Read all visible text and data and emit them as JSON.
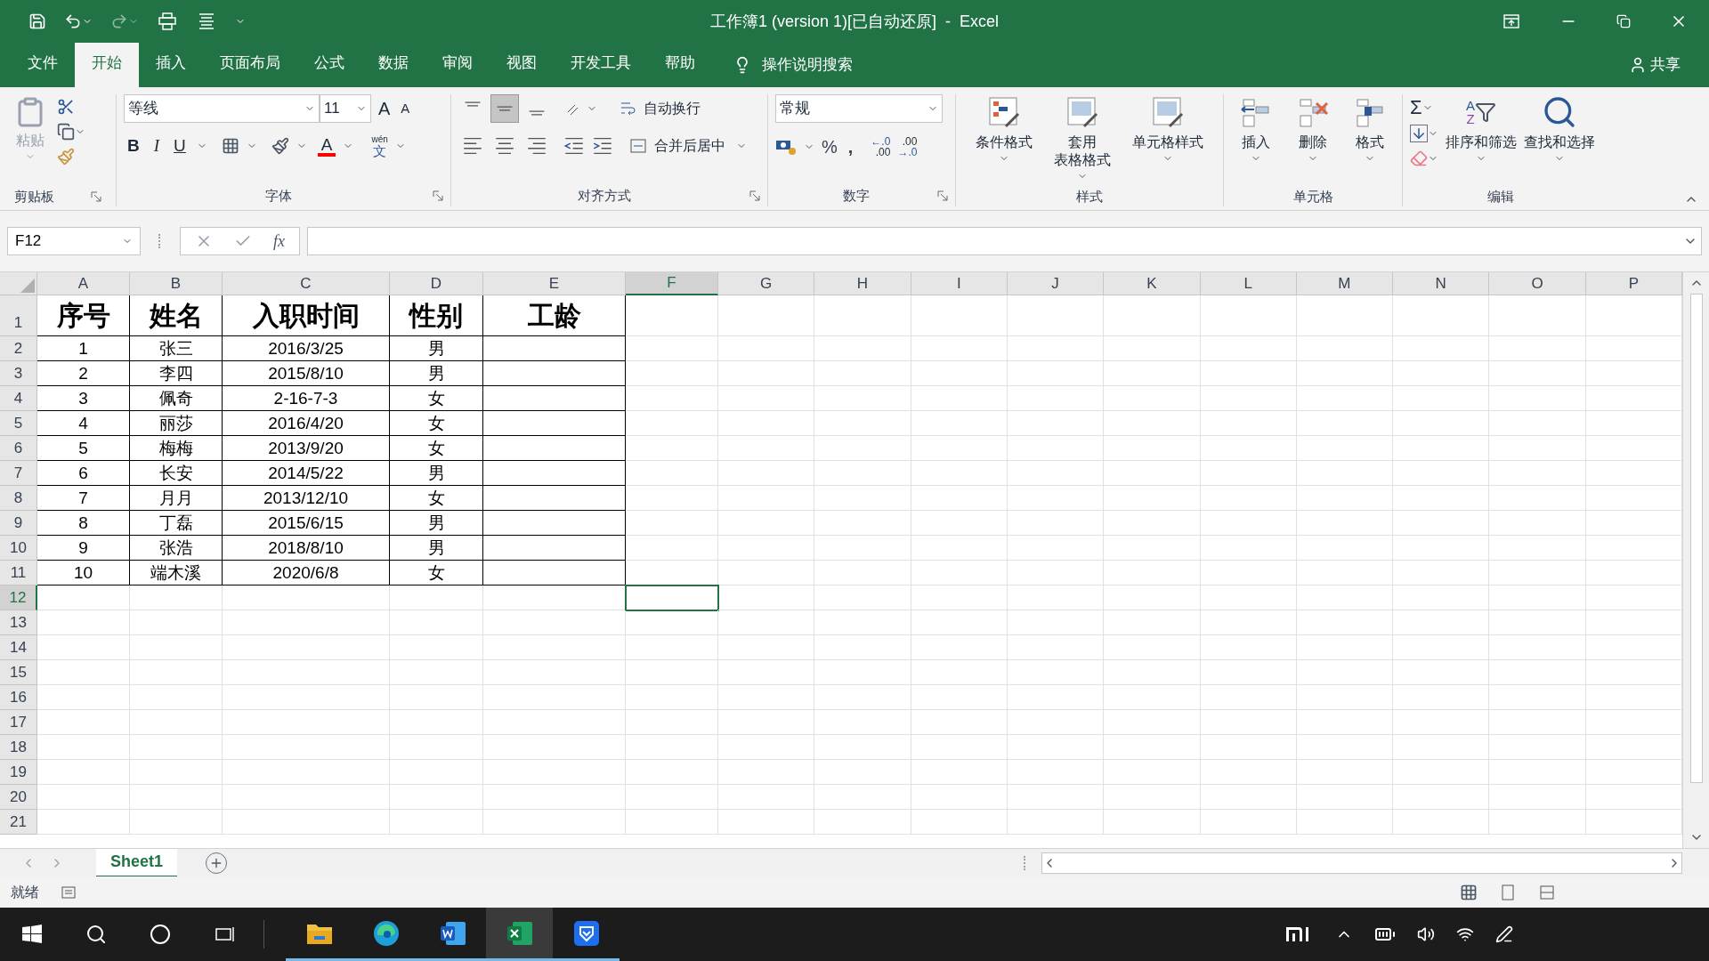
{
  "window": {
    "title": "工作簿1 (version 1)[已自动还原]  -  Excel"
  },
  "menu_tabs": [
    {
      "label": "文件",
      "selected": false
    },
    {
      "label": "开始",
      "selected": true
    },
    {
      "label": "插入",
      "selected": false
    },
    {
      "label": "页面布局",
      "selected": false
    },
    {
      "label": "公式",
      "selected": false
    },
    {
      "label": "数据",
      "selected": false
    },
    {
      "label": "审阅",
      "selected": false
    },
    {
      "label": "视图",
      "selected": false
    },
    {
      "label": "开发工具",
      "selected": false
    },
    {
      "label": "帮助",
      "selected": false
    }
  ],
  "tell_me": "操作说明搜索",
  "share": "共享",
  "ribbon": {
    "clipboard": {
      "paste": "粘贴",
      "label": "剪贴板"
    },
    "font": {
      "name": "等线",
      "size": "11",
      "grow": "A",
      "shrink": "A",
      "bold": "B",
      "italic": "I",
      "underline": "U",
      "font_color": "A",
      "phonetic_top": "wén",
      "phonetic_bottom": "文",
      "label": "字体"
    },
    "alignment": {
      "vertical": [
        {
          "selected": false
        },
        {
          "selected": true
        },
        {
          "selected": false
        }
      ],
      "wrap_text": "自动换行",
      "merge": "合并后居中",
      "label": "对齐方式"
    },
    "number": {
      "format": "常规",
      "percent": "%",
      "comma": ",",
      "increase_decimal": [
        "←.0",
        ".00"
      ],
      "decrease_decimal": [
        ".00",
        "→.0"
      ],
      "label": "数字"
    },
    "styles": {
      "buttons": [
        [
          "条件格式"
        ],
        [
          "套用",
          "表格格式"
        ],
        [
          "单元格样式"
        ]
      ],
      "label": "样式"
    },
    "cells": {
      "buttons": [
        "插入",
        "删除",
        "格式"
      ],
      "label": "单元格"
    },
    "editing": {
      "sum": "Σ",
      "sort_letters": [
        "A",
        "Z"
      ],
      "buttons": [
        "排序和筛选",
        "查找和选择"
      ],
      "label": "编辑"
    }
  },
  "formula_bar": {
    "name_box": "F12",
    "fx": "fx"
  },
  "sheet": {
    "columns": [
      {
        "label": "A",
        "selected": false
      },
      {
        "label": "B",
        "selected": false
      },
      {
        "label": "C",
        "selected": false
      },
      {
        "label": "D",
        "selected": false
      },
      {
        "label": "E",
        "selected": false
      },
      {
        "label": "F",
        "selected": true
      },
      {
        "label": "G",
        "selected": false
      },
      {
        "label": "H",
        "selected": false
      },
      {
        "label": "I",
        "selected": false
      },
      {
        "label": "J",
        "selected": false
      },
      {
        "label": "K",
        "selected": false
      },
      {
        "label": "L",
        "selected": false
      },
      {
        "label": "M",
        "selected": false
      },
      {
        "label": "N",
        "selected": false
      },
      {
        "label": "O",
        "selected": false
      },
      {
        "label": "P",
        "selected": false
      }
    ],
    "rows": [
      {
        "label": "1",
        "selected": false,
        "cells": [
          "序号",
          "姓名",
          "入职时间",
          "性别",
          "工龄"
        ]
      },
      {
        "label": "2",
        "selected": false,
        "cells": [
          "1",
          "张三",
          "2016/3/25",
          "男"
        ]
      },
      {
        "label": "3",
        "selected": false,
        "cells": [
          "2",
          "李四",
          "2015/8/10",
          "男"
        ]
      },
      {
        "label": "4",
        "selected": false,
        "cells": [
          "3",
          "佩奇",
          "2-16-7-3",
          "女"
        ]
      },
      {
        "label": "5",
        "selected": false,
        "cells": [
          "4",
          "丽莎",
          "2016/4/20",
          "女"
        ]
      },
      {
        "label": "6",
        "selected": false,
        "cells": [
          "5",
          "梅梅",
          "2013/9/20",
          "女"
        ]
      },
      {
        "label": "7",
        "selected": false,
        "cells": [
          "6",
          "长安",
          "2014/5/22",
          "男"
        ]
      },
      {
        "label": "8",
        "selected": false,
        "cells": [
          "7",
          "月月",
          "2013/12/10",
          "女"
        ]
      },
      {
        "label": "9",
        "selected": false,
        "cells": [
          "8",
          "丁磊",
          "2015/6/15",
          "男"
        ]
      },
      {
        "label": "10",
        "selected": false,
        "cells": [
          "9",
          "张浩",
          "2018/8/10",
          "男"
        ]
      },
      {
        "label": "11",
        "selected": false,
        "cells": [
          "10",
          "端木溪",
          "2020/6/8",
          "女"
        ]
      },
      {
        "label": "12",
        "selected": true
      },
      {
        "label": "13",
        "selected": false
      },
      {
        "label": "14",
        "selected": false
      },
      {
        "label": "15",
        "selected": false
      },
      {
        "label": "16",
        "selected": false
      },
      {
        "label": "17",
        "selected": false
      },
      {
        "label": "18",
        "selected": false
      },
      {
        "label": "19",
        "selected": false
      },
      {
        "label": "20",
        "selected": false
      },
      {
        "label": "21",
        "selected": false
      }
    ]
  },
  "sheet_tabs": [
    {
      "label": "Sheet1",
      "selected": true
    }
  ],
  "status": "就绪",
  "taskbar_apps": [
    {
      "kind": "folder",
      "running": true
    },
    {
      "kind": "edge",
      "running": true
    },
    {
      "kind": "word",
      "running": true
    },
    {
      "kind": "excel",
      "running": true
    },
    {
      "kind": "shield",
      "running": true
    }
  ]
}
